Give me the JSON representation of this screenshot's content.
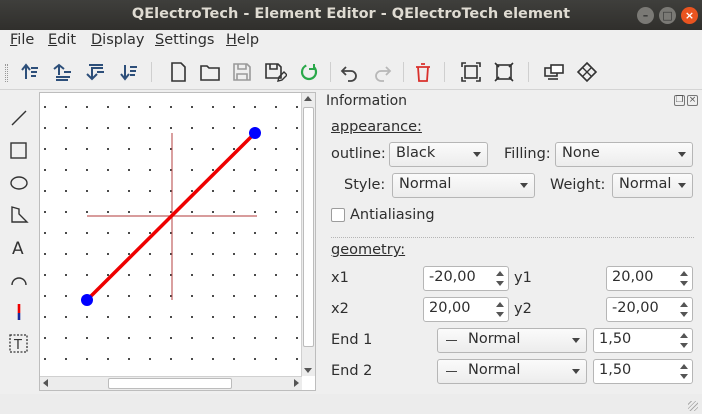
{
  "window": {
    "title": "QElectroTech - Element Editor - QElectroTech element",
    "controls": [
      "–",
      "□",
      "×"
    ]
  },
  "menu": [
    "File",
    "Edit",
    "Display",
    "Settings",
    "Help"
  ],
  "toolbar": [
    "raise-icon",
    "bring-forward-icon",
    "send-backward-icon",
    "lower-icon",
    "new-file-icon",
    "open-folder-icon",
    "save-icon",
    "save-as-icon",
    "reload-icon",
    "undo-icon",
    "redo-icon",
    "delete-icon",
    "zoom-fit-icon",
    "zoom-reset-icon",
    "terminal-icon",
    "rotate-icon"
  ],
  "tools": [
    "line-icon",
    "rectangle-icon",
    "ellipse-icon",
    "polygon-icon",
    "text-icon",
    "arc-icon",
    "terminal-icon",
    "dynamic-text-icon"
  ],
  "colors": {
    "accent": "#e95420",
    "line": "#ee0000",
    "endpoint": "#0000ff",
    "cross": "#c06060"
  },
  "panel": {
    "title": "Information",
    "appearance_label": "appearance:",
    "outline_label": "outline:",
    "outline_value": "Black",
    "filling_label": "Filling:",
    "filling_value": "None",
    "style_label": "Style:",
    "style_value": "Normal",
    "weight_label": "Weight:",
    "weight_value": "Normal",
    "antialiasing_label": "Antialiasing",
    "antialiasing_checked": false,
    "geometry_label": "geometry:",
    "x1_label": "x1",
    "x1_value": "-20,00",
    "y1_label": "y1",
    "y1_value": "20,00",
    "x2_label": "x2",
    "x2_value": "20,00",
    "y2_label": "y2",
    "y2_value": "-20,00",
    "end1_label": "End 1",
    "end1_value": "Normal",
    "end1_size": "1,50",
    "end2_label": "End 2",
    "end2_value": "Normal",
    "end2_size": "1,50"
  }
}
